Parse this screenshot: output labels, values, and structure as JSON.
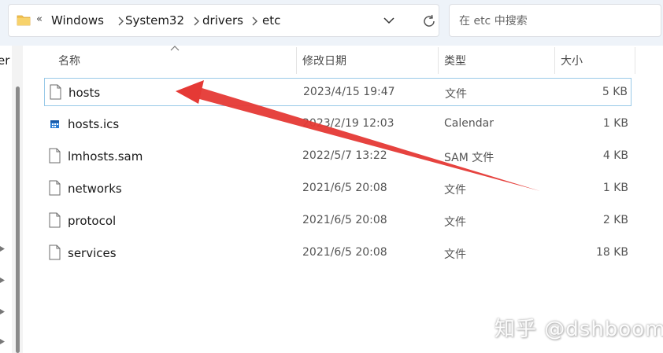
{
  "address_bar": {
    "overflow": "«",
    "crumbs": [
      "Windows",
      "System32",
      "drivers",
      "etc"
    ]
  },
  "search": {
    "placeholder": "在 etc 中搜索"
  },
  "left_pane": {
    "cut_text": "er"
  },
  "columns": {
    "name": "名称",
    "date": "修改日期",
    "type": "类型",
    "size": "大小"
  },
  "files": [
    {
      "name": "hosts",
      "date": "2023/4/15 19:47",
      "type": "文件",
      "size": "5 KB",
      "icon": "file-icon"
    },
    {
      "name": "hosts.ics",
      "date": "2023/2/19 12:03",
      "type": "Calendar",
      "size": "1 KB",
      "icon": "calendar-file-icon"
    },
    {
      "name": "lmhosts.sam",
      "date": "2022/5/7 13:22",
      "type": "SAM 文件",
      "size": "4 KB",
      "icon": "file-icon"
    },
    {
      "name": "networks",
      "date": "2021/6/5 20:08",
      "type": "文件",
      "size": "1 KB",
      "icon": "file-icon"
    },
    {
      "name": "protocol",
      "date": "2021/6/5 20:08",
      "type": "文件",
      "size": "2 KB",
      "icon": "file-icon"
    },
    {
      "name": "services",
      "date": "2021/6/5 20:08",
      "type": "文件",
      "size": "18 KB",
      "icon": "file-icon"
    }
  ],
  "watermark": "知乎 @dshboom",
  "colors": {
    "annotation_arrow": "#e53935",
    "selection_border": "#99c9e8",
    "folder": "#f2c14e"
  }
}
